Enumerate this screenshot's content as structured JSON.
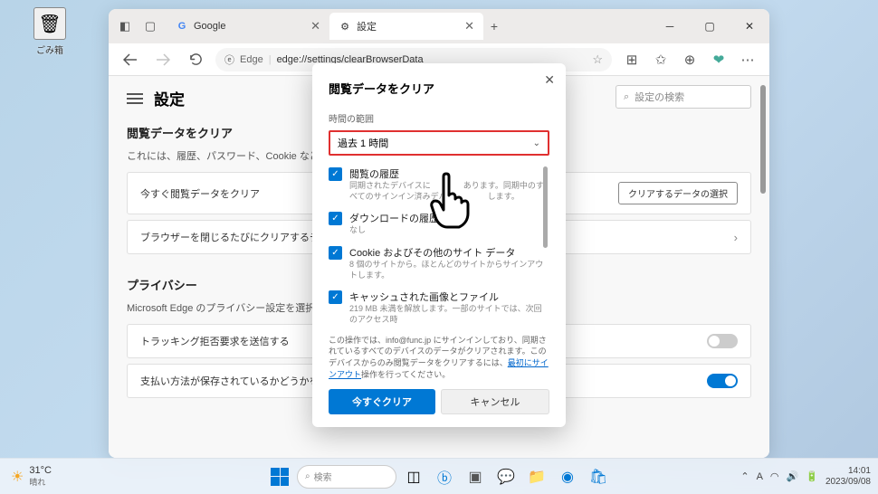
{
  "desktop": {
    "recycle_bin": "ごみ箱"
  },
  "window": {
    "tabs": [
      {
        "title": "Google",
        "favicon": "G"
      },
      {
        "title": "設定",
        "favicon": "⚙"
      }
    ],
    "url_label": "Edge",
    "url": "edge://settings/clearBrowserData"
  },
  "page": {
    "title": "設定",
    "search_placeholder": "設定の検索",
    "section1": {
      "title": "閲覧データをクリア",
      "desc": "これには、履歴、パスワード、Cookie などが",
      "row1": "今すぐ閲覧データをクリア",
      "row1_btn": "クリアするデータの選択",
      "row2": "ブラウザーを閉じるたびにクリアするデータ"
    },
    "section2": {
      "title": "プライバシー",
      "desc": "Microsoft Edge のプライバシー設定を選択",
      "row1": "トラッキング拒否要求を送信する",
      "row2": "支払い方法が保存されているかどうかを"
    }
  },
  "modal": {
    "title": "閲覧データをクリア",
    "time_label": "時間の範囲",
    "time_value": "過去 1 時間",
    "items": [
      {
        "title": "閲覧の履歴",
        "sub": "同期されたデバイスに　　　　あります。同期中のすべてのサインイン済みデバイ　　　　します。"
      },
      {
        "title": "ダウンロードの履歴",
        "sub": "なし"
      },
      {
        "title": "Cookie およびその他のサイト データ",
        "sub": "8 個のサイトから。ほとんどのサイトからサインアウトします。"
      },
      {
        "title": "キャッシュされた画像とファイル",
        "sub": "219 MB 未満を解放します。一部のサイトでは、次回のアクセス時"
      }
    ],
    "info_pre": "この操作では、info@func.jp にサインインしており、同期されているすべてのデバイスのデータがクリアされます。このデバイスからのみ閲覧データをクリアするには、",
    "info_link": "最初にサインアウト",
    "info_post": "操作を行ってください。",
    "btn_primary": "今すぐクリア",
    "btn_secondary": "キャンセル"
  },
  "taskbar": {
    "temp": "31°C",
    "cond": "晴れ",
    "search": "検索",
    "time": "14:01",
    "date": "2023/09/08",
    "ime": "A"
  }
}
